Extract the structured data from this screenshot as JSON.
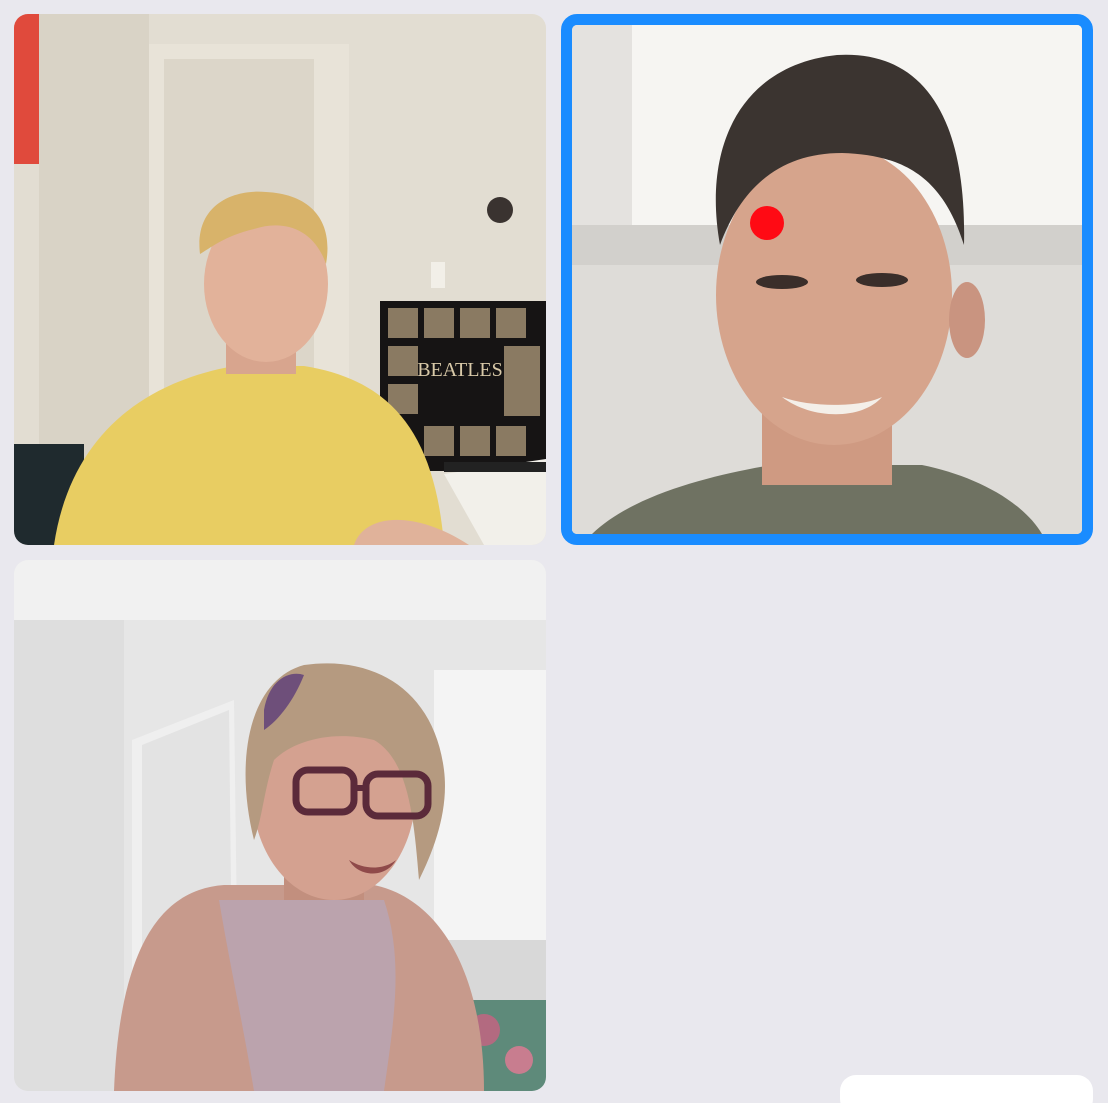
{
  "call": {
    "participants": [
      {
        "id": "participant-1",
        "active_speaker": false,
        "poster_text": "BEATLES"
      },
      {
        "id": "participant-2",
        "active_speaker": true
      },
      {
        "id": "participant-3",
        "active_speaker": false
      }
    ],
    "active_speaker_color": "#1a8cff",
    "indicator_color": "#ff0a14",
    "background_color": "#e9e8ee"
  }
}
